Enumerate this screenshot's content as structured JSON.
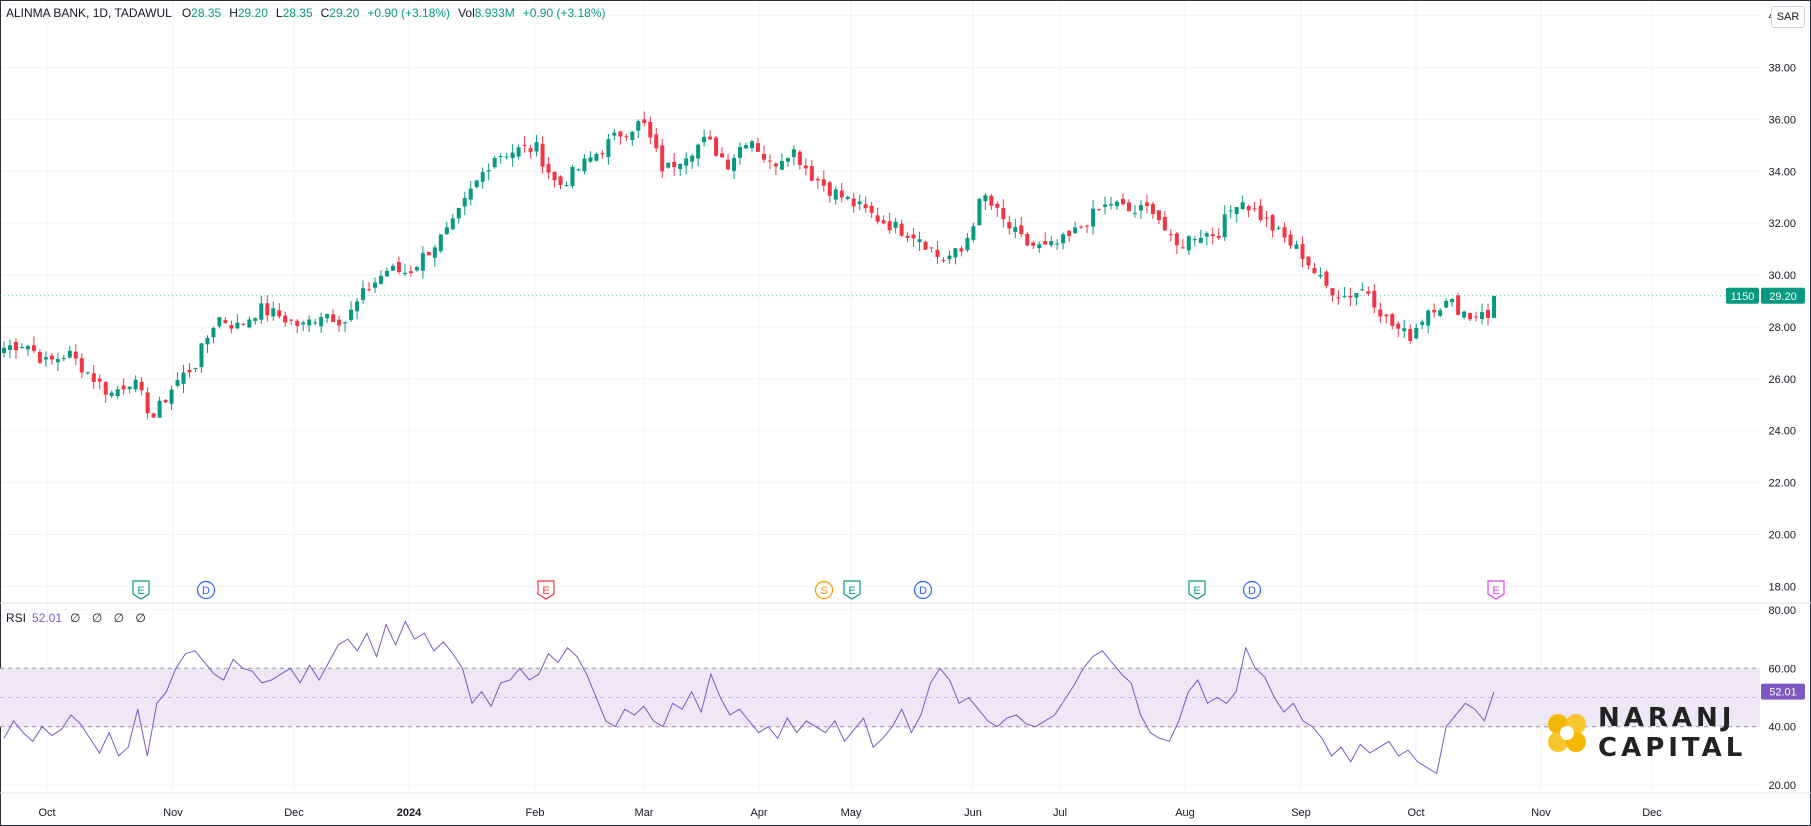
{
  "legend": {
    "symbol": "ALINMA BANK, 1D, TADAWUL",
    "o_label": "O",
    "o_value": "28.35",
    "h_label": "H",
    "h_value": "29.20",
    "l_label": "L",
    "l_value": "28.35",
    "c_label": "C",
    "c_value": "29.20",
    "change": "+0.90 (+3.18%)",
    "vol_label": "Vol",
    "vol_value": "8.933M",
    "vol_change": "+0.90 (+3.18%)"
  },
  "currency": "SAR",
  "price_badge": {
    "countdown": "1150",
    "last": "29.20"
  },
  "rsi": {
    "label": "RSI",
    "value": "52.01",
    "placeholders": "∅ ∅ ∅ ∅",
    "badge": "52.01"
  },
  "logo": {
    "line1": "NARANJ",
    "line2": "CAPITAL"
  },
  "colors": {
    "up": "#089981",
    "down": "#f23645",
    "rsi_line": "#7e57c2",
    "rsi_band": "#ede7f6",
    "grid": "#f0f3fa",
    "text": "#131722"
  },
  "chart_data": [
    {
      "type": "candlestick",
      "title": "ALINMA BANK, 1D, TADAWUL",
      "yaxis_ticks": [
        "40.00",
        "38.00",
        "36.00",
        "34.00",
        "32.00",
        "30.00",
        "28.00",
        "26.00",
        "24.00",
        "22.00",
        "20.00",
        "18.00"
      ],
      "ylim": [
        17.4,
        40.6
      ],
      "xaxis_ticks": [
        "Oct",
        "Nov",
        "Dec",
        "2024",
        "Feb",
        "Mar",
        "Apr",
        "May",
        "Jun",
        "Jul",
        "Aug",
        "Sep",
        "Oct",
        "Nov",
        "Dec"
      ],
      "close_path": [
        [
          "Oct",
          27.2
        ],
        [
          "Oct",
          27.4
        ],
        [
          "Oct",
          26.6
        ],
        [
          "Oct",
          27.0
        ],
        [
          "Oct",
          26.2
        ],
        [
          "Oct",
          25.4
        ],
        [
          "Oct",
          26.0
        ],
        [
          "Oct",
          24.5
        ],
        [
          "Oct",
          25.8
        ],
        [
          "Nov",
          26.6
        ],
        [
          "Nov",
          28.4
        ],
        [
          "Nov",
          28.0
        ],
        [
          "Nov",
          28.7
        ],
        [
          "Nov",
          28.4
        ],
        [
          "Nov",
          28.0
        ],
        [
          "Dec",
          28.6
        ],
        [
          "Dec",
          28.2
        ],
        [
          "Dec",
          29.4
        ],
        [
          "Dec",
          30.2
        ],
        [
          "Dec",
          30.1
        ],
        [
          "2024",
          31.0
        ],
        [
          "2024",
          31.8
        ],
        [
          "2024",
          33.3
        ],
        [
          "2024",
          34.6
        ],
        [
          "2024",
          34.8
        ],
        [
          "Feb",
          34.9
        ],
        [
          "Feb",
          33.4
        ],
        [
          "Feb",
          34.1
        ],
        [
          "Feb",
          34.8
        ],
        [
          "Feb",
          35.5
        ],
        [
          "Mar",
          35.9
        ],
        [
          "Mar",
          34.0
        ],
        [
          "Mar",
          34.7
        ],
        [
          "Mar",
          35.2
        ],
        [
          "Mar",
          34.3
        ],
        [
          "Apr",
          35.4
        ],
        [
          "Apr",
          34.2
        ],
        [
          "Apr",
          34.9
        ],
        [
          "Apr",
          33.8
        ],
        [
          "Apr",
          33.2
        ],
        [
          "May",
          32.7
        ],
        [
          "May",
          32.2
        ],
        [
          "May",
          31.8
        ],
        [
          "May",
          31.5
        ],
        [
          "May",
          30.6
        ],
        [
          "Jun",
          30.9
        ],
        [
          "Jun",
          33.1
        ],
        [
          "Jun",
          32.0
        ],
        [
          "Jun",
          31.2
        ],
        [
          "Jun",
          31.0
        ],
        [
          "Jul",
          31.4
        ],
        [
          "Jul",
          32.2
        ],
        [
          "Jul",
          32.8
        ],
        [
          "Jul",
          32.4
        ],
        [
          "Jul",
          32.6
        ],
        [
          "Aug",
          31.0
        ],
        [
          "Aug",
          31.6
        ],
        [
          "Aug",
          31.6
        ],
        [
          "Aug",
          33.0
        ],
        [
          "Aug",
          32.3
        ],
        [
          "Sep",
          31.5
        ],
        [
          "Sep",
          30.8
        ],
        [
          "Sep",
          29.6
        ],
        [
          "Sep",
          29.2
        ],
        [
          "Sep",
          29.5
        ],
        [
          "Oct",
          28.2
        ],
        [
          "Oct",
          27.6
        ],
        [
          "Oct",
          28.8
        ],
        [
          "Oct",
          28.9
        ],
        [
          "Oct",
          28.35
        ],
        [
          "Oct",
          29.2
        ]
      ],
      "last_candle": {
        "open": 28.35,
        "high": 29.2,
        "low": 28.35,
        "close": 29.2,
        "change": "+0.90 (+3.18%)",
        "volume": "8.933M"
      },
      "event_markers": [
        {
          "label": "E",
          "kind": "earnings",
          "month": "Nov"
        },
        {
          "label": "D",
          "kind": "dividend",
          "month": "Nov"
        },
        {
          "label": "E",
          "kind": "earnings",
          "month": "Feb"
        },
        {
          "label": "S",
          "kind": "split",
          "month": "Apr"
        },
        {
          "label": "E",
          "kind": "earnings",
          "month": "Apr"
        },
        {
          "label": "D",
          "kind": "dividend",
          "month": "May"
        },
        {
          "label": "E",
          "kind": "earnings",
          "month": "Aug"
        },
        {
          "label": "D",
          "kind": "dividend",
          "month": "Aug"
        },
        {
          "label": "E",
          "kind": "earnings",
          "month": "Oct"
        }
      ]
    },
    {
      "type": "line",
      "title": "RSI",
      "series_value": 52.01,
      "yaxis_ticks": [
        "80.00",
        "60.00",
        "40.00",
        "20.00"
      ],
      "ylim": [
        18,
        82
      ],
      "band": [
        40,
        60
      ],
      "midline": 50,
      "values": [
        36,
        42,
        38,
        35,
        40,
        37,
        39,
        44,
        41,
        36,
        31,
        38,
        30,
        33,
        46,
        30,
        48,
        52,
        60,
        65,
        66,
        62,
        58,
        56,
        63,
        60,
        59,
        55,
        56,
        58,
        60,
        55,
        61,
        56,
        62,
        68,
        70,
        66,
        72,
        64,
        75,
        68,
        76,
        70,
        72,
        66,
        69,
        65,
        60,
        48,
        52,
        47,
        55,
        56,
        60,
        56,
        58,
        65,
        62,
        67,
        64,
        58,
        50,
        42,
        40,
        46,
        44,
        47,
        42,
        40,
        48,
        46,
        52,
        45,
        58,
        50,
        44,
        46,
        42,
        38,
        40,
        36,
        43,
        38,
        42,
        40,
        38,
        42,
        35,
        39,
        43,
        33,
        36,
        40,
        46,
        38,
        44,
        55,
        60,
        56,
        48,
        50,
        46,
        42,
        40,
        43,
        44,
        41,
        40,
        42,
        44,
        49,
        54,
        60,
        64,
        66,
        62,
        58,
        55,
        44,
        38,
        36,
        35,
        42,
        52,
        56,
        48,
        50,
        48,
        52,
        67,
        60,
        57,
        50,
        45,
        48,
        42,
        40,
        36,
        30,
        33,
        28,
        34,
        31,
        33,
        35,
        30,
        32,
        28,
        26,
        24,
        40,
        44,
        48,
        46,
        42,
        52
      ]
    }
  ]
}
